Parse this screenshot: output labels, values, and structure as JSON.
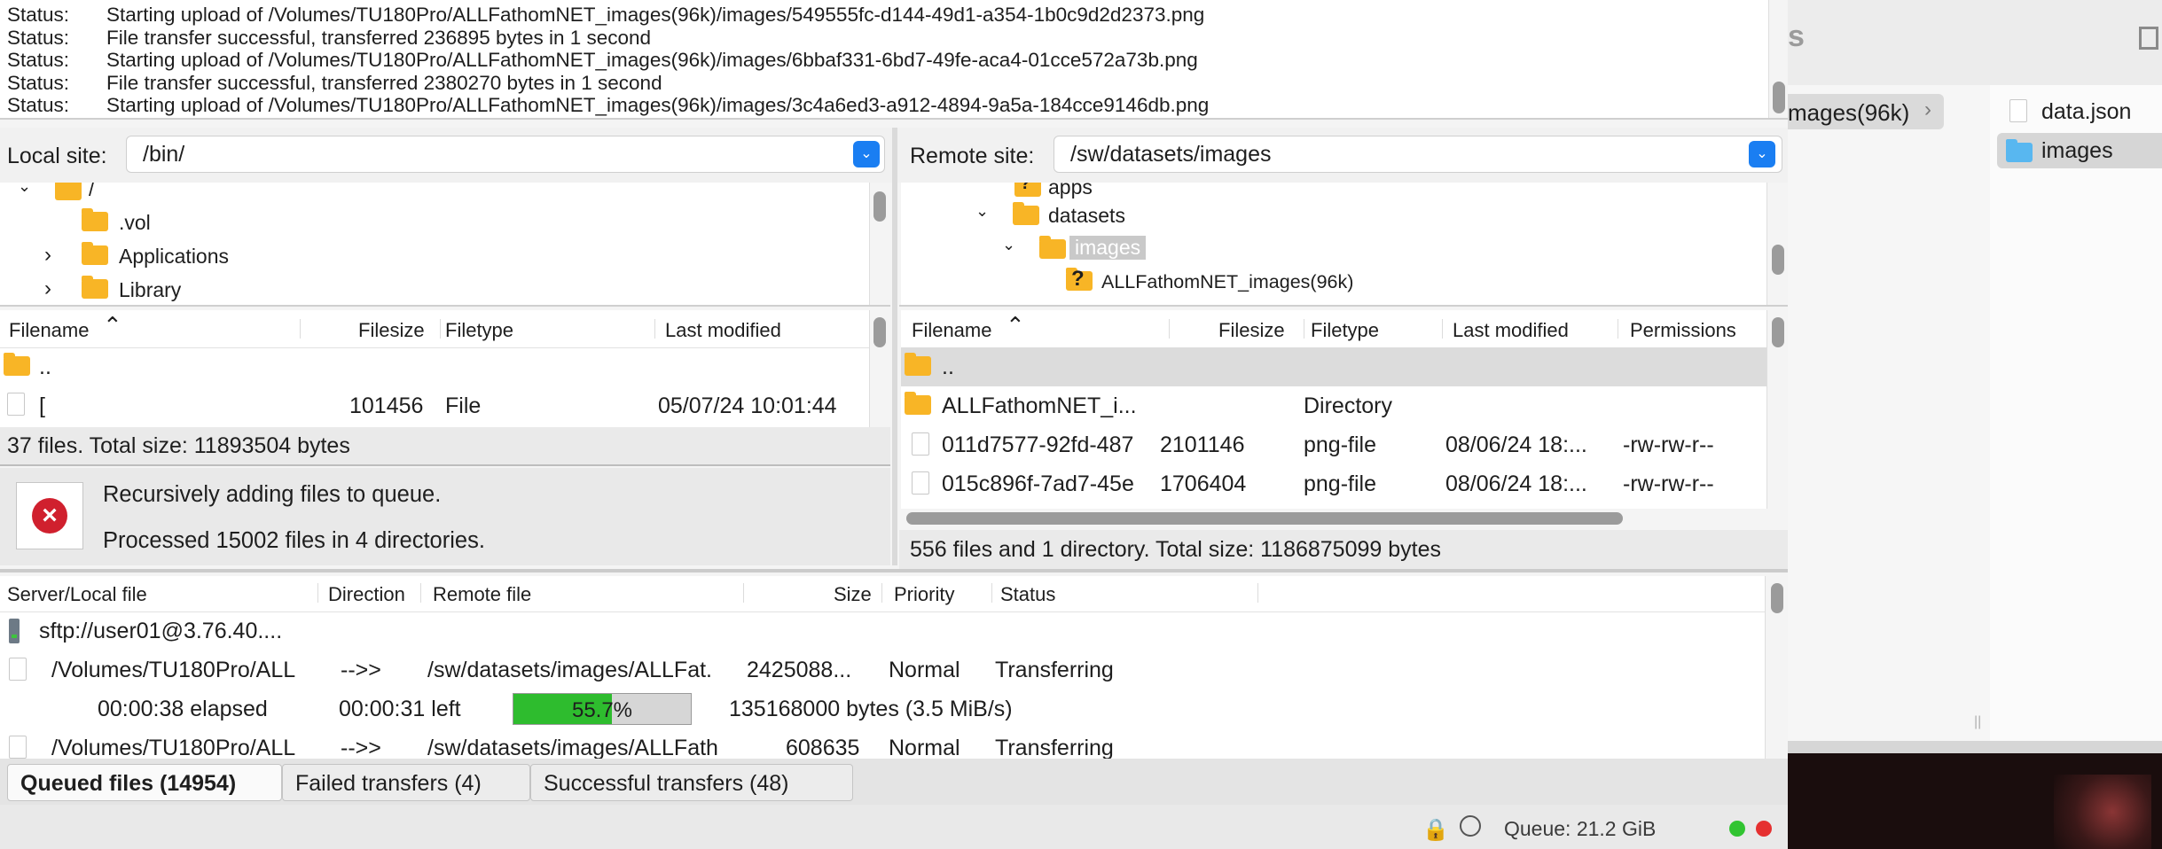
{
  "log": {
    "lines": [
      {
        "k": "Status:",
        "v": "Starting upload of /Volumes/TU180Pro/ALLFathomNET_images(96k)/images/549555fc-d144-49d1-a354-1b0c9d2d2373.png"
      },
      {
        "k": "Status:",
        "v": "File transfer successful, transferred 236895 bytes in 1 second"
      },
      {
        "k": "Status:",
        "v": "Starting upload of /Volumes/TU180Pro/ALLFathomNET_images(96k)/images/6bbaf331-6bd7-49fe-aca4-01cce572a73b.png"
      },
      {
        "k": "Status:",
        "v": "File transfer successful, transferred 2380270 bytes in 1 second"
      },
      {
        "k": "Status:",
        "v": "Starting upload of /Volumes/TU180Pro/ALLFathomNET_images(96k)/images/3c4a6ed3-a912-4894-9a5a-184cce9146db.png"
      }
    ]
  },
  "local": {
    "label": "Local site:",
    "path": "/bin/",
    "tree": [
      {
        "name": "/",
        "depth": 0,
        "expanded": true
      },
      {
        "name": ".vol",
        "depth": 1
      },
      {
        "name": "Applications",
        "depth": 1,
        "collapsed": true
      },
      {
        "name": "Library",
        "depth": 1,
        "collapsed": true
      }
    ],
    "columns": [
      "Filename",
      "Filesize",
      "Filetype",
      "Last modified"
    ],
    "files": [
      {
        "name": "..",
        "size": "",
        "type": "",
        "modified": ""
      },
      {
        "name": "[",
        "size": "101456",
        "type": "File",
        "modified": "05/07/24 10:01:44"
      }
    ],
    "status": "37 files. Total size: 11893504 bytes",
    "notice": {
      "line1": "Recursively adding files to queue.",
      "line2": "Processed 15002 files in 4 directories."
    }
  },
  "remote": {
    "label": "Remote site:",
    "path": "/sw/datasets/images",
    "tree": [
      {
        "name": "apps"
      },
      {
        "name": "datasets"
      },
      {
        "name": "images"
      },
      {
        "name": "ALLFathomNET_images(96k)"
      }
    ],
    "columns": [
      "Filename",
      "Filesize",
      "Filetype",
      "Last modified",
      "Permissions"
    ],
    "files": [
      {
        "name": "..",
        "size": "",
        "type": "",
        "modified": "",
        "perms": ""
      },
      {
        "name": "ALLFathomNET_i...",
        "size": "",
        "type": "Directory",
        "modified": "",
        "perms": ""
      },
      {
        "name": "011d7577-92fd-487",
        "size": "2101146",
        "type": "png-file",
        "modified": "08/06/24 18:...",
        "perms": "-rw-rw-r--"
      },
      {
        "name": "015c896f-7ad7-45e",
        "size": "1706404",
        "type": "png-file",
        "modified": "08/06/24 18:...",
        "perms": "-rw-rw-r--"
      }
    ],
    "status": "556 files and 1 directory. Total size: 1186875099 bytes"
  },
  "queue": {
    "columns": [
      "Server/Local file",
      "Direction",
      "Remote file",
      "Size",
      "Priority",
      "Status"
    ],
    "server": "sftp://user01@3.76.40....",
    "rows": [
      {
        "local": "/Volumes/TU180Pro/ALL",
        "dir": "-->>",
        "remote": "/sw/datasets/images/ALLFat.",
        "size": "2425088...",
        "priority": "Normal",
        "status": "Transferring"
      },
      {
        "local": "/Volumes/TU180Pro/ALL",
        "dir": "-->>",
        "remote": "/sw/datasets/images/ALLFath",
        "size": "608635",
        "priority": "Normal",
        "status": "Transferring"
      }
    ],
    "progress": {
      "elapsed": "00:00:38 elapsed",
      "left": "00:00:31 left",
      "percent_label": "55.7%",
      "percent": 55.7,
      "bytes": "135168000 bytes (3.5 MiB/s)"
    }
  },
  "tabs": [
    "Queued files (14954)",
    "Failed transfers (4)",
    "Successful transfers (48)"
  ],
  "statusbar": {
    "queue": "Queue: 21.2 GiB"
  },
  "finder": {
    "header_partial": "s",
    "path_partial": "mages(96k)",
    "items": [
      "data.json",
      "images"
    ]
  },
  "colors": {
    "accent": "#1a7ef2",
    "progress": "#2ebc2e",
    "error": "#d0202e",
    "folder": "#f8b526"
  }
}
